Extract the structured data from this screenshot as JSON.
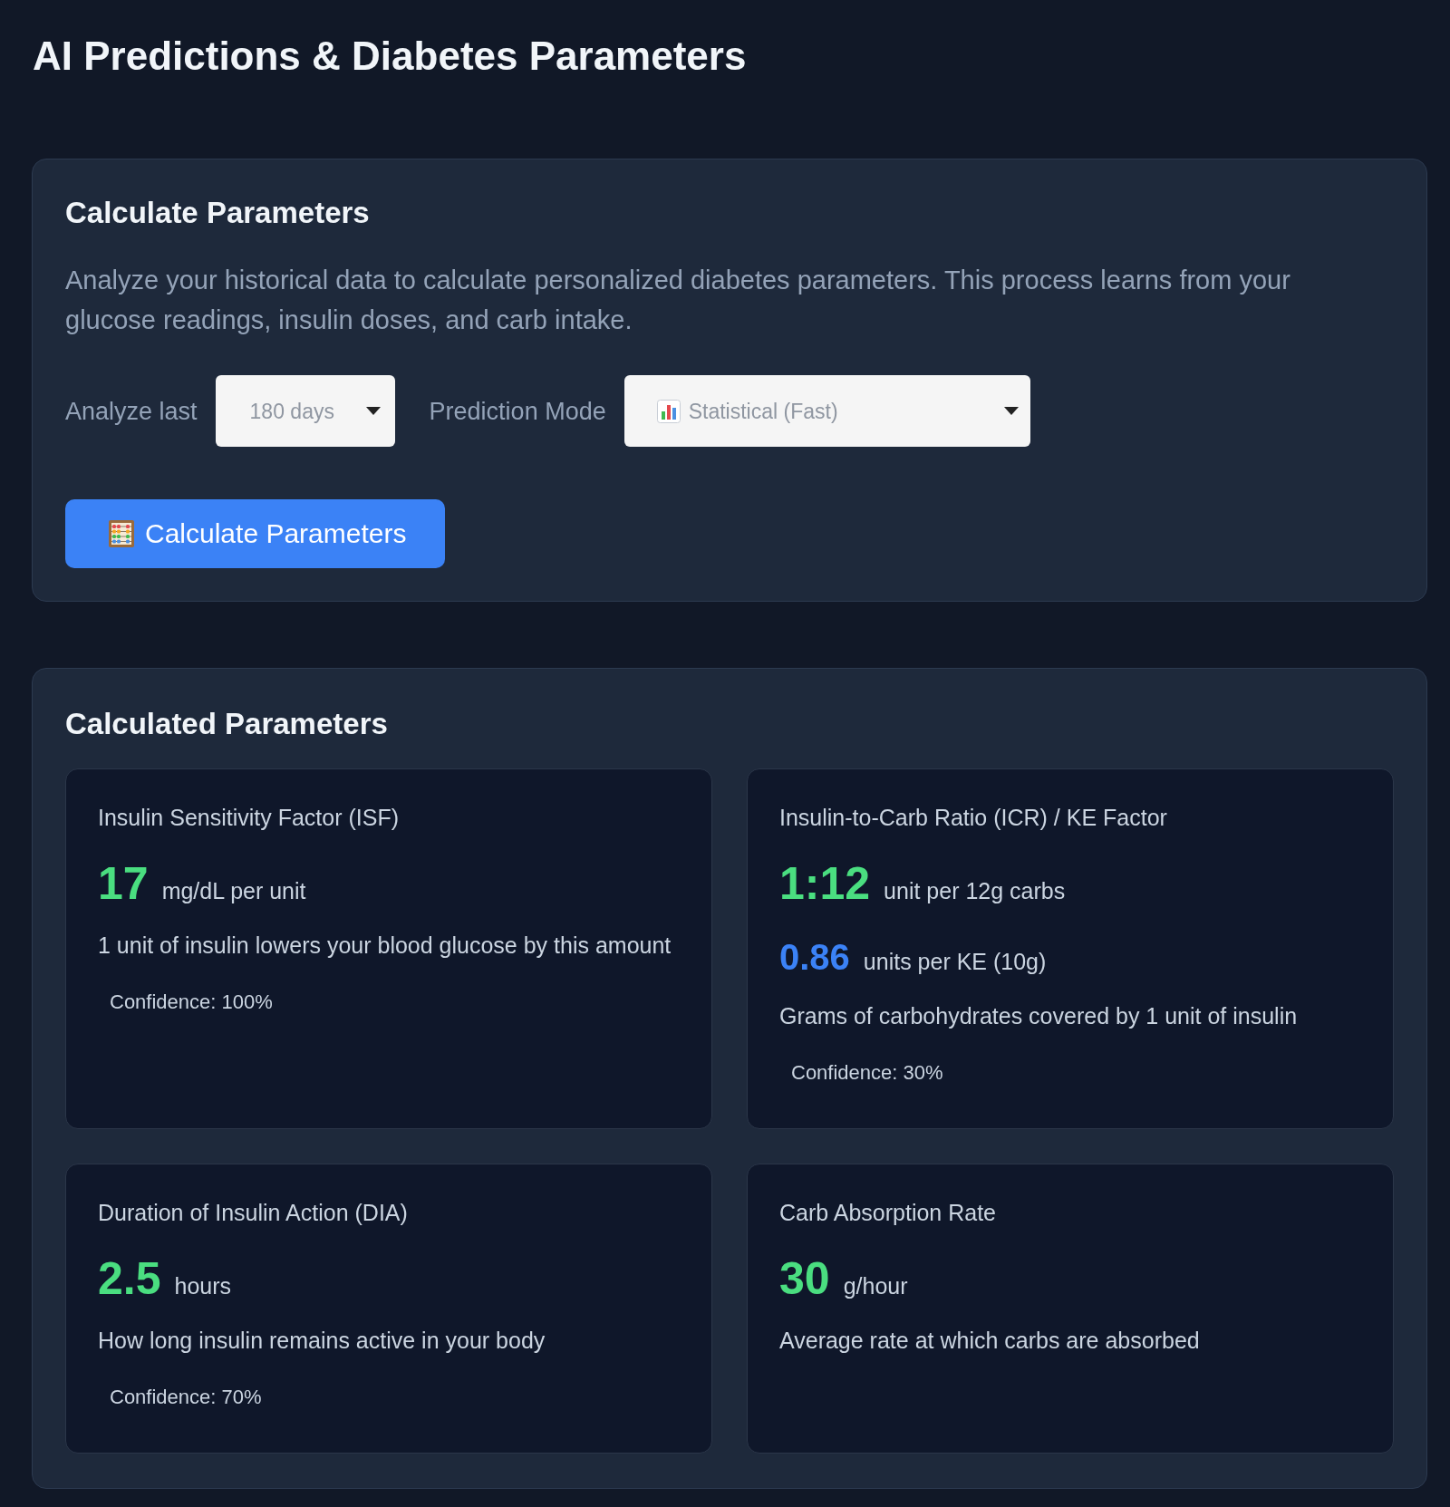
{
  "page_title": "AI Predictions & Diabetes Parameters",
  "calculate_panel": {
    "title": "Calculate Parameters",
    "description": "Analyze your historical data to calculate personalized diabetes parameters. This process learns from your glucose readings, insulin doses, and carb intake.",
    "fields": [
      {
        "kind": "period",
        "label": "Analyze last",
        "value": "180 days"
      },
      {
        "kind": "mode",
        "label": "Prediction Mode",
        "value": "Statistical (Fast)"
      }
    ],
    "button": {
      "label": "Calculate Parameters"
    }
  },
  "results_panel": {
    "title": "Calculated Parameters",
    "cards": [
      {
        "title": "Insulin Sensitivity Factor (ISF)",
        "values": [
          {
            "kind": "primary",
            "value": "17",
            "unit": "mg/dL per unit"
          }
        ],
        "description": "1 unit of insulin lowers your blood glucose by this amount",
        "confidence": "Confidence: 100%"
      },
      {
        "title": "Insulin-to-Carb Ratio (ICR) / KE Factor",
        "values": [
          {
            "kind": "primary",
            "value": "1:12",
            "unit": "unit per 12g carbs"
          },
          {
            "kind": "secondary",
            "value": "0.86",
            "unit": "units per KE (10g)"
          }
        ],
        "description": "Grams of carbohydrates covered by 1 unit of insulin",
        "confidence": "Confidence: 30%"
      },
      {
        "title": "Duration of Insulin Action (DIA)",
        "values": [
          {
            "kind": "primary",
            "value": "2.5",
            "unit": "hours"
          }
        ],
        "description": "How long insulin remains active in your body",
        "confidence": "Confidence: 70%"
      },
      {
        "title": "Carb Absorption Rate",
        "values": [
          {
            "kind": "primary",
            "value": "30",
            "unit": "g/hour"
          }
        ],
        "description": "Average rate at which carbs are absorbed"
      }
    ]
  }
}
